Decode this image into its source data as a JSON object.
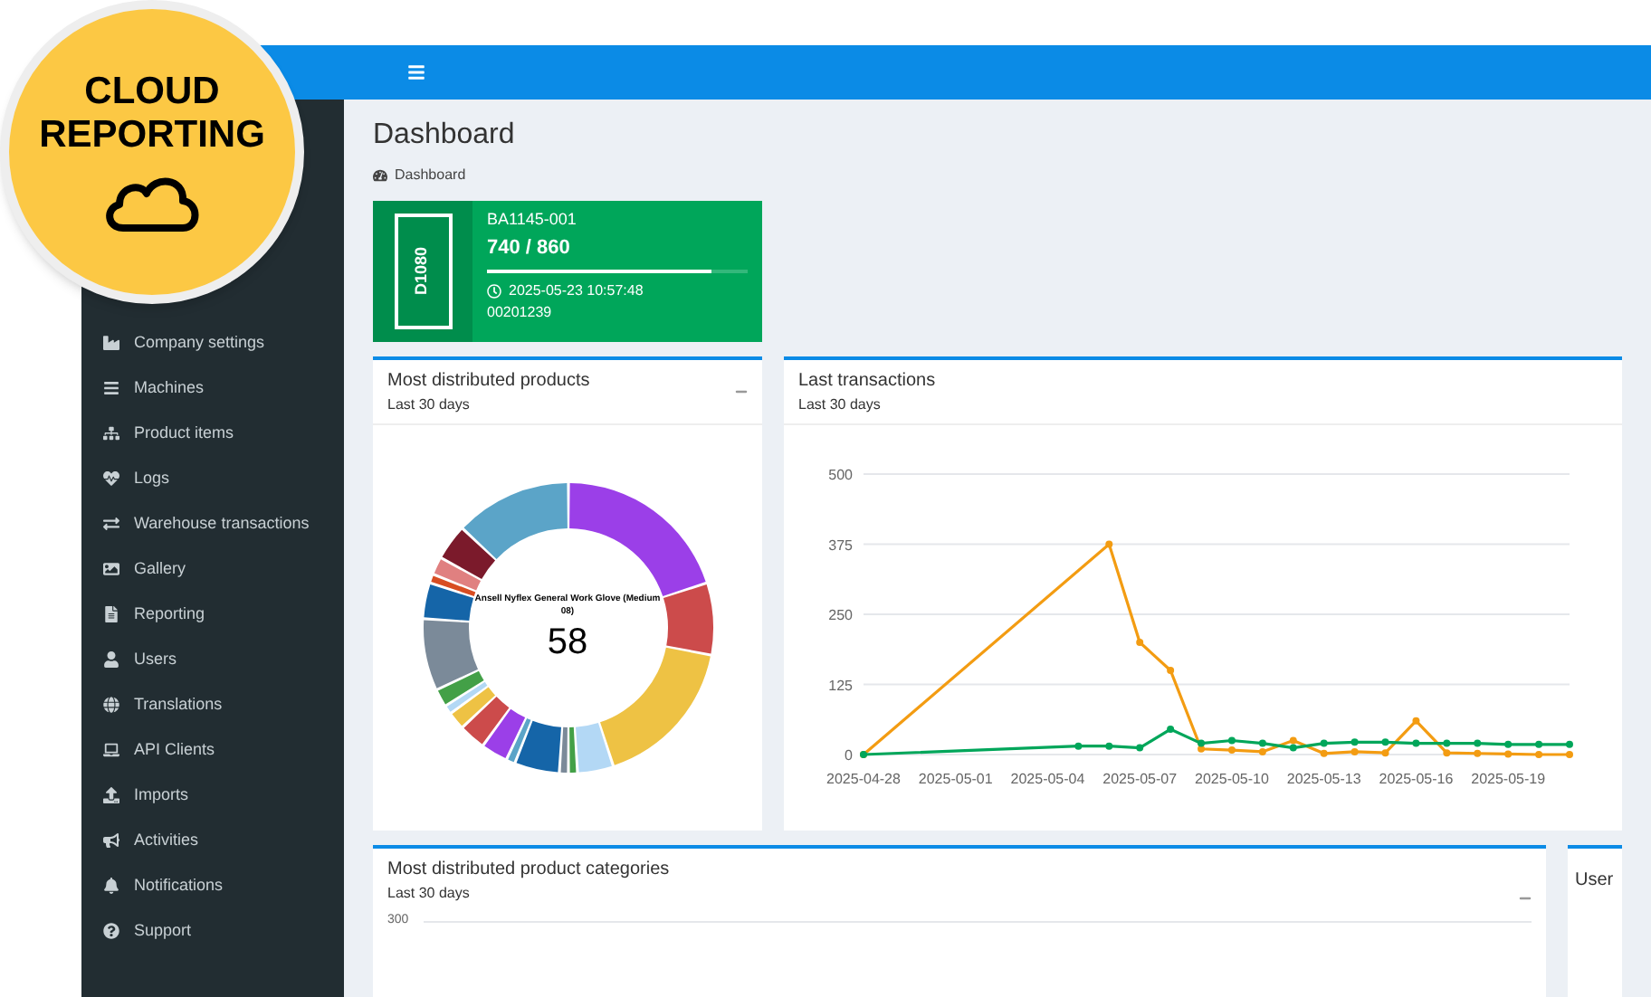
{
  "badge": {
    "line_1": "CLOUD",
    "line_2": "REPORTING"
  },
  "sidebar": {
    "items": [
      {
        "label": "Company settings",
        "kind": "industry"
      },
      {
        "label": "Machines",
        "kind": "machines"
      },
      {
        "label": "Product items",
        "kind": "sitemap"
      },
      {
        "label": "Logs",
        "kind": "heartbeat"
      },
      {
        "label": "Warehouse transactions",
        "kind": "exchange"
      },
      {
        "label": "Gallery",
        "kind": "image"
      },
      {
        "label": "Reporting",
        "kind": "report"
      },
      {
        "label": "Users",
        "kind": "user"
      },
      {
        "label": "Translations",
        "kind": "globe"
      },
      {
        "label": "API Clients",
        "kind": "laptop"
      },
      {
        "label": "Imports",
        "kind": "upload"
      },
      {
        "label": "Activities",
        "kind": "bullhorn"
      },
      {
        "label": "Notifications",
        "kind": "bell"
      },
      {
        "label": "Support",
        "kind": "question"
      }
    ]
  },
  "page": {
    "title": "Dashboard",
    "breadcrumb": "Dashboard"
  },
  "machine": {
    "model": "D1080",
    "name": "BA1145-001",
    "count": "740 / 860",
    "level": 0.86,
    "timestamp": "2025-05-23 10:57:48",
    "serial": "00201239"
  },
  "products_card": {
    "title": "Most distributed products",
    "subtitle": "Last 30 days",
    "center_label": "Ansell Nyflex General Work Glove (Medium 08)",
    "center_value": "58"
  },
  "transactions_card": {
    "title": "Last transactions",
    "subtitle": "Last 30 days",
    "chart_data": {
      "type": "line",
      "categories": [
        "2025-04-28",
        null,
        null,
        "2025-05-01",
        null,
        null,
        "2025-05-04",
        null,
        null,
        "2025-05-07",
        null,
        null,
        "2025-05-10",
        null,
        null,
        "2025-05-13",
        null,
        null,
        "2025-05-16",
        null,
        null,
        "2025-05-19",
        null,
        null
      ],
      "series": [
        {
          "color": "#f39c12",
          "marker": "circle",
          "values": [
            0,
            null,
            null,
            null,
            null,
            null,
            null,
            null,
            375,
            200,
            150,
            10,
            8,
            5,
            25,
            2,
            5,
            3,
            60,
            3,
            2,
            1,
            0,
            0
          ]
        },
        {
          "color": "#00a65a",
          "marker": "circle",
          "values": [
            0,
            null,
            null,
            null,
            null,
            null,
            null,
            15,
            15,
            12,
            45,
            20,
            25,
            20,
            12,
            20,
            22,
            22,
            20,
            20,
            20,
            18,
            18,
            18
          ]
        }
      ],
      "ylim": [
        0,
        500
      ],
      "grid": true,
      "yticks": [
        0,
        125,
        250,
        375,
        500
      ]
    }
  },
  "categories_card": {
    "title": "Most distributed product categories",
    "subtitle": "Last 30 days",
    "axis_label": "300"
  },
  "users_card": {
    "title": "User"
  }
}
